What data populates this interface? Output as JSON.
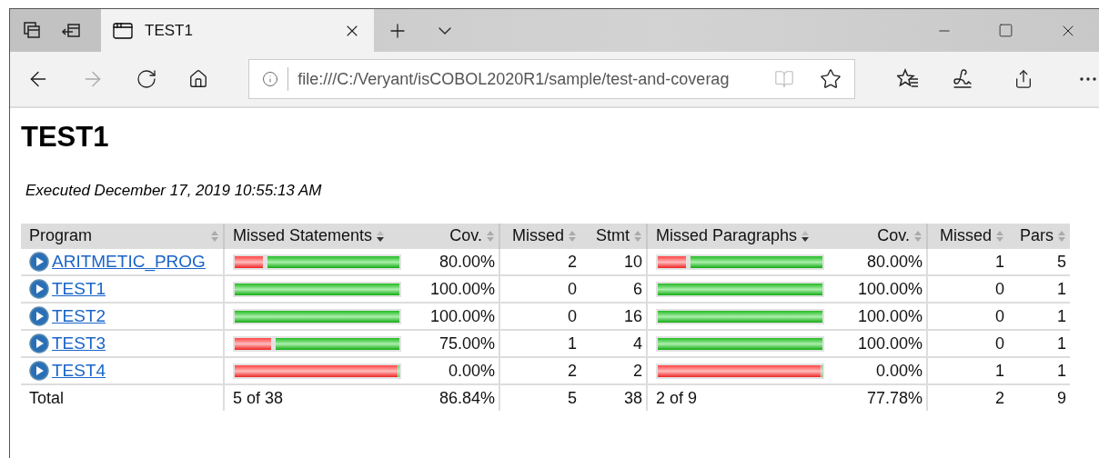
{
  "browser": {
    "tab_title": "TEST1",
    "address": "file:///C:/Veryant/isCOBOL2020R1/sample/test-and-coverag",
    "forward_button": {
      "disabled": true
    }
  },
  "page": {
    "title": "TEST1",
    "executed": "Executed December 17, 2019 10:55:13 AM"
  },
  "table": {
    "columns": [
      {
        "label": "Program",
        "sorted": false
      },
      {
        "label": "Missed Statements",
        "sorted": true
      },
      {
        "label": "Cov.",
        "sorted": false
      },
      {
        "label": "Missed",
        "sorted": false
      },
      {
        "label": "Stmt",
        "sorted": false
      },
      {
        "label": "Missed Paragraphs",
        "sorted": true
      },
      {
        "label": "Cov.",
        "sorted": false
      },
      {
        "label": "Missed",
        "sorted": false
      },
      {
        "label": "Pars",
        "sorted": false
      }
    ],
    "rows": [
      {
        "program": "ARITMETIC_PROG",
        "statements": {
          "level": 0.8,
          "cov": "80.00%",
          "missed": "2",
          "total": "10"
        },
        "paragraphs": {
          "level": 0.8,
          "cov": "80.00%",
          "missed": "1",
          "total": "5"
        }
      },
      {
        "program": "TEST1",
        "statements": {
          "level": 1,
          "cov": "100.00%",
          "missed": "0",
          "total": "6"
        },
        "paragraphs": {
          "level": 1,
          "cov": "100.00%",
          "missed": "0",
          "total": "1"
        }
      },
      {
        "program": "TEST2",
        "statements": {
          "level": 1,
          "cov": "100.00%",
          "missed": "0",
          "total": "16"
        },
        "paragraphs": {
          "level": 1,
          "cov": "100.00%",
          "missed": "0",
          "total": "1"
        }
      },
      {
        "program": "TEST3",
        "statements": {
          "level": 0.75,
          "cov": "75.00%",
          "missed": "1",
          "total": "4"
        },
        "paragraphs": {
          "level": 1,
          "cov": "100.00%",
          "missed": "0",
          "total": "1"
        }
      },
      {
        "program": "TEST4",
        "statements": {
          "level": 0,
          "cov": "0.00%",
          "missed": "2",
          "total": "2"
        },
        "paragraphs": {
          "level": 0,
          "cov": "0.00%",
          "missed": "1",
          "total": "1"
        }
      }
    ],
    "total": {
      "label": "Total",
      "statements": {
        "summary": "5 of 38",
        "cov": "86.84%",
        "missed": "5",
        "total": "38"
      },
      "paragraphs": {
        "summary": "2 of 9",
        "cov": "77.78%",
        "missed": "2",
        "total": "9"
      }
    }
  }
}
